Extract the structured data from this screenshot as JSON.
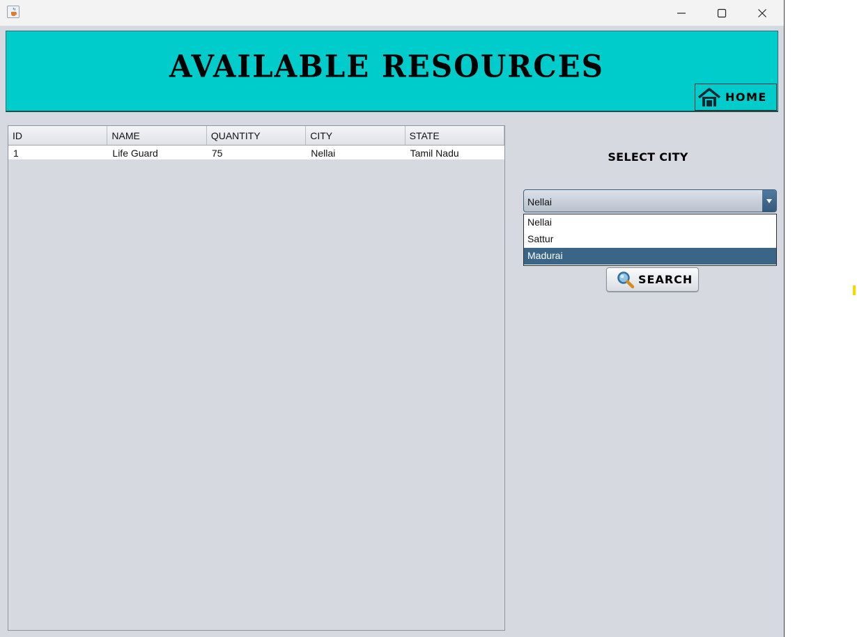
{
  "window": {
    "icon": "java-cup-icon",
    "controls": {
      "minimize": "minimize-icon",
      "maximize": "maximize-icon",
      "close": "close-icon"
    }
  },
  "header": {
    "title": "AVAILABLE RESOURCES",
    "home_button": {
      "label": "HOME",
      "icon": "home-icon"
    },
    "color": "#00cccc"
  },
  "table": {
    "columns": [
      "ID",
      "NAME",
      "QUANTITY",
      "CITY",
      "STATE"
    ],
    "rows": [
      [
        "1",
        "Life Guard",
        "75",
        "Nellai",
        "Tamil Nadu"
      ]
    ]
  },
  "filter": {
    "label": "SELECT CITY",
    "selected_value": "Nellai",
    "options": [
      "Nellai",
      "Sattur",
      "Madurai"
    ],
    "highlighted_option": "Madurai",
    "search_button": {
      "label": "SEARCH",
      "icon": "magnifier-icon"
    }
  }
}
